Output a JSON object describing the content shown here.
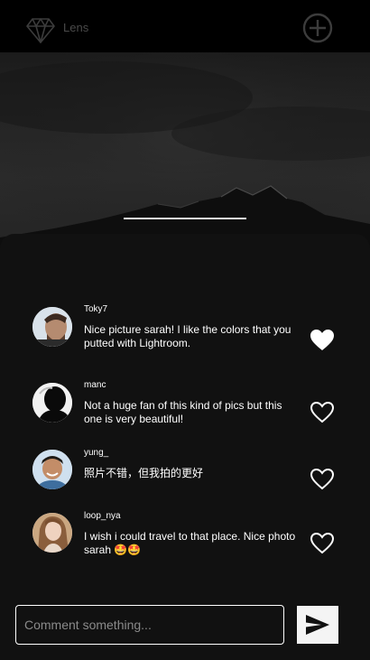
{
  "app": {
    "name": "Lens",
    "logo_icon": "diamond-icon",
    "add_icon": "plus-circle-icon"
  },
  "comments": [
    {
      "username": "Toky7",
      "text": "Nice picture sarah! I like the colors that you putted with Lightroom.",
      "liked": true
    },
    {
      "username": "manc",
      "text": "Not a huge fan of this kind of pics but this one is very beautiful!",
      "liked": false
    },
    {
      "username": "yung_",
      "text": "照片不错，但我拍的更好",
      "liked": false
    },
    {
      "username": "loop_nya",
      "text": "I wish i could travel to that place. Nice photo sarah 🤩🤩",
      "liked": false
    }
  ],
  "composer": {
    "placeholder": "Comment something...",
    "send_icon": "send-arrow-icon"
  },
  "colors": {
    "sheet": "#111111",
    "topbar": "#000000",
    "accent": "#ffffff"
  }
}
